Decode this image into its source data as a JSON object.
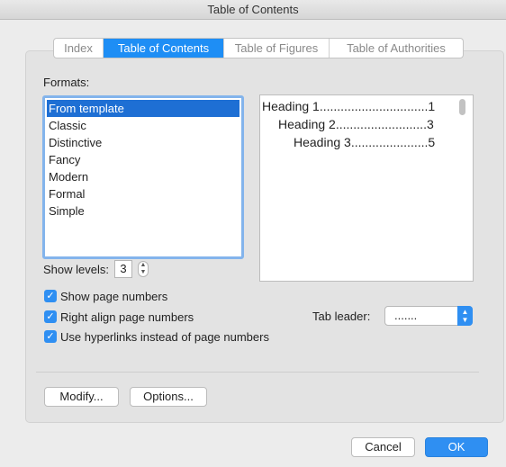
{
  "window": {
    "title": "Table of Contents"
  },
  "tabs": [
    {
      "label": "Index",
      "active": false
    },
    {
      "label": "Table of Contents",
      "active": true
    },
    {
      "label": "Table of Figures",
      "active": false
    },
    {
      "label": "Table of Authorities",
      "active": false
    }
  ],
  "formats": {
    "label": "Formats:",
    "items": [
      "From template",
      "Classic",
      "Distinctive",
      "Fancy",
      "Modern",
      "Formal",
      "Simple"
    ],
    "selected": "From template"
  },
  "preview": {
    "lines": [
      "Heading 1...............................1",
      "Heading 2..........................3",
      "Heading 3......................5"
    ]
  },
  "show_levels": {
    "label": "Show levels:",
    "value": "3"
  },
  "checkboxes": [
    {
      "label": "Show page numbers",
      "checked": true
    },
    {
      "label": "Right align page numbers",
      "checked": true
    },
    {
      "label": "Use hyperlinks instead of page numbers",
      "checked": true
    }
  ],
  "tab_leader": {
    "label": "Tab leader:",
    "value": "......."
  },
  "buttons": {
    "modify": "Modify...",
    "options": "Options...",
    "cancel": "Cancel",
    "ok": "OK"
  },
  "colors": {
    "accent": "#2f8ff2",
    "selection": "#1e6fd4"
  }
}
